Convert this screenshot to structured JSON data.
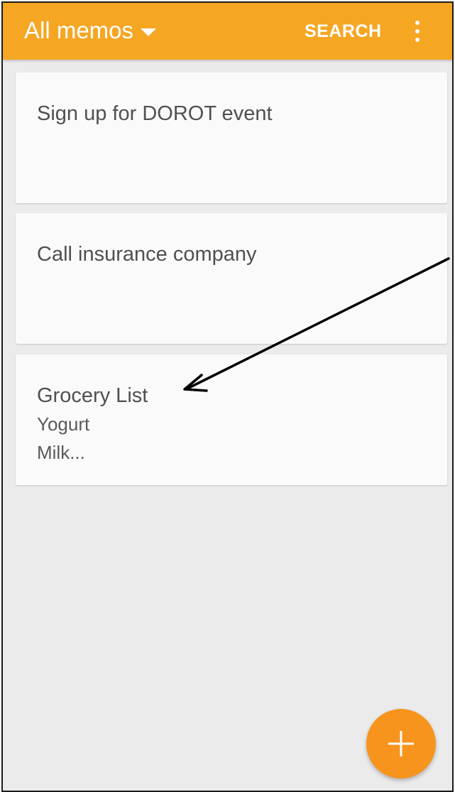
{
  "app_bar": {
    "title": "All memos",
    "search_label": "SEARCH",
    "accent_color": "#f5a623",
    "icons": {
      "dropdown": "caret-down-icon",
      "more": "more-vertical-icon"
    }
  },
  "memos": [
    {
      "title": "Sign up for DOROT event",
      "lines": []
    },
    {
      "title": "Call insurance company",
      "lines": []
    },
    {
      "title": "Grocery List",
      "lines": [
        "Yogurt",
        "Milk..."
      ]
    }
  ],
  "fab": {
    "icon": "plus-icon",
    "color": "#f7941d"
  },
  "annotation": {
    "icon": "arrow-icon",
    "color": "#000000"
  }
}
